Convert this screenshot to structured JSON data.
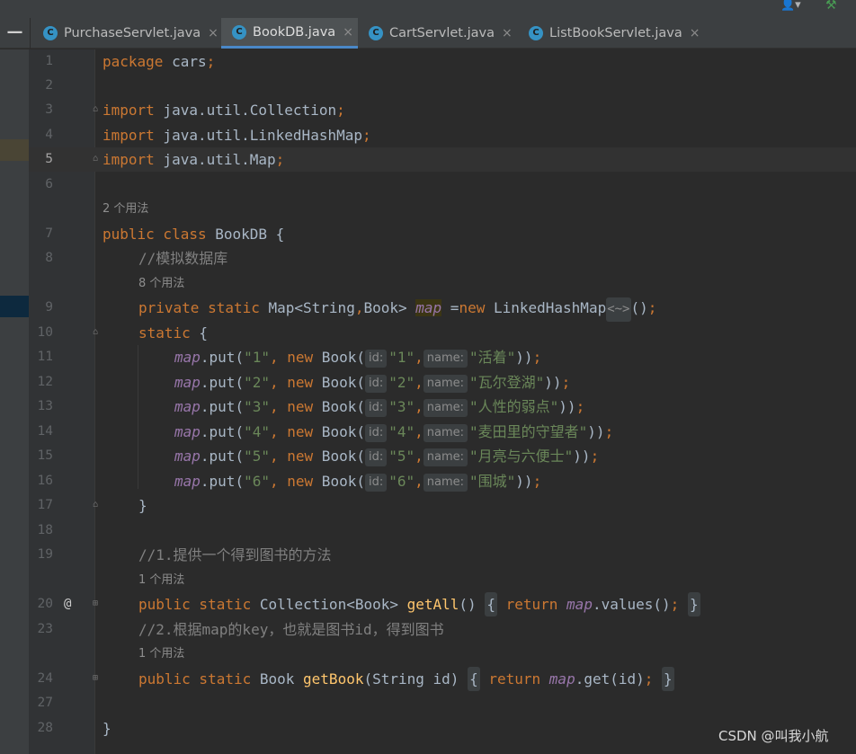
{
  "tabs": [
    {
      "label": "PurchaseServlet.java",
      "active": false
    },
    {
      "label": "BookDB.java",
      "active": true
    },
    {
      "label": "CartServlet.java",
      "active": false
    },
    {
      "label": "ListBookServlet.java",
      "active": false
    }
  ],
  "tab_icon_letter": "C",
  "close_glyph": "×",
  "minimize_glyph": "—",
  "usages": {
    "class": "2 个用法",
    "map_field": "8 个用法",
    "getAll": "1 个用法",
    "getBook": "1 个用法"
  },
  "lines": {
    "l1": "1",
    "l2": "2",
    "l3": "3",
    "l4": "4",
    "l5": "5",
    "l6": "6",
    "l7": "7",
    "l8": "8",
    "l9": "9",
    "l10": "10",
    "l11": "11",
    "l12": "12",
    "l13": "13",
    "l14": "14",
    "l15": "15",
    "l16": "16",
    "l17": "17",
    "l18": "18",
    "l19": "19",
    "l20": "20",
    "l23": "23",
    "l24": "24",
    "l27": "27",
    "l28": "28"
  },
  "code": {
    "package_kw": "package",
    "package_name": " cars",
    "import_kw": "import",
    "import1": " java.util.Collection",
    "import2": " java.util.LinkedHashMap",
    "import3": " java.util.Map",
    "semi": ";",
    "class_decl_kw": "public class",
    "class_name": " BookDB {",
    "comment_db": "//模拟数据库",
    "field_mods": "private static",
    "field_type": " Map<String",
    "field_type2": "Book> ",
    "field_name": "map",
    "field_assign": " =",
    "new_kw": "new",
    "field_init": " LinkedHashMap",
    "diamond": "<~>",
    "field_end": "()",
    "static_kw": "static",
    "static_open": " {",
    "close_brace": "}",
    "comment_getall": "//1.提供一个得到图书的方法",
    "getall_mods": "public static",
    "getall_type": " Collection<Book> ",
    "getall_name": "getAll",
    "getall_parens": "()",
    "return_kw": "return",
    "values_call": ".values()",
    "comment_getbook": "//2.根据map的key，也就是图书id，得到图书",
    "getbook_mods": "public static",
    "getbook_type": " Book ",
    "getbook_name": "getBook",
    "getbook_params": "(String id)",
    "get_call": ".get(id)",
    "end_brace": "}",
    "override_marker": "@"
  },
  "put_rows": [
    {
      "key": "\"1\"",
      "id": "\"1\"",
      "name": "\"活着\""
    },
    {
      "key": "\"2\"",
      "id": "\"2\"",
      "name": "\"瓦尔登湖\""
    },
    {
      "key": "\"3\"",
      "id": "\"3\"",
      "name": "\"人性的弱点\""
    },
    {
      "key": "\"4\"",
      "id": "\"4\"",
      "name": "\"麦田里的守望者\""
    },
    {
      "key": "\"5\"",
      "id": "\"5\"",
      "name": "\"月亮与六便士\""
    },
    {
      "key": "\"6\"",
      "id": "\"6\"",
      "name": "\"围城\""
    }
  ],
  "put_parts": {
    "map": "map",
    "put": ".put(",
    "comma": ",",
    "new_kw": "new",
    "book": " Book(",
    "id_hint": "id:",
    "name_hint": "name:",
    "end": "))",
    "semi": ";"
  },
  "watermark": "CSDN @叫我小航"
}
